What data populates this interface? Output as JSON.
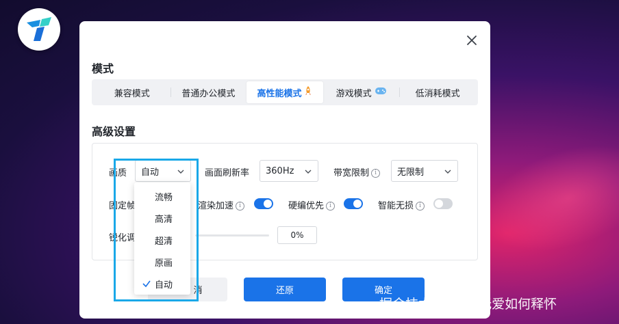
{
  "mode_section": {
    "title": "模式"
  },
  "mode_tabs": [
    {
      "label": "兼容模式",
      "icon": ""
    },
    {
      "label": "普通办公模式",
      "icon": ""
    },
    {
      "label": "高性能模式",
      "icon": "rocket-icon",
      "active": true
    },
    {
      "label": "游戏模式",
      "icon": "gamepad-icon"
    },
    {
      "label": "低消耗模式",
      "icon": ""
    }
  ],
  "advanced_section": {
    "title": "高级设置"
  },
  "settings": {
    "quality_label": "画质",
    "quality_value": "自动",
    "refresh_label": "画面刷新率",
    "refresh_value": "360Hz",
    "bandwidth_label": "带宽限制",
    "bandwidth_value": "无限制",
    "fixed_fps_label": "固定帧",
    "render_accel_label": "渲染加速",
    "render_accel_on": true,
    "hw_encode_label": "硬编优先",
    "hw_encode_on": true,
    "smart_lossless_label": "智能无损",
    "smart_lossless_on": false,
    "sharpen_label": "锐化调",
    "sharpen_value": "0%"
  },
  "dropdown": {
    "options": [
      "流畅",
      "高清",
      "超清",
      "原画",
      "自动"
    ],
    "selected": "自动"
  },
  "buttons": {
    "cancel_partial": "消",
    "restore": "还原",
    "confirm": "确定"
  },
  "watermark": "掘金技术社区 @ 无爱如何释怀",
  "colors": {
    "accent": "#1a73e8",
    "highlight_border": "#1aa8e8"
  }
}
